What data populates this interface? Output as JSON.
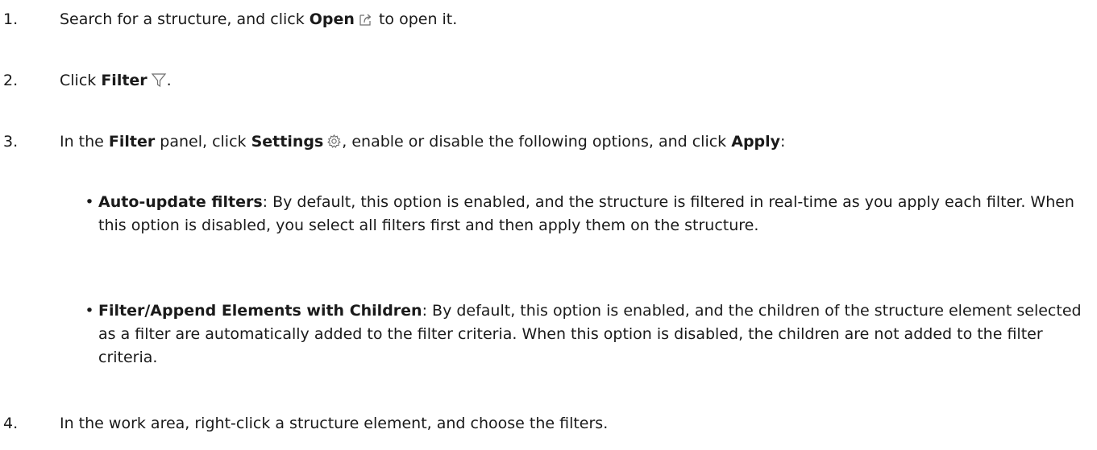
{
  "steps": [
    {
      "number": "1.",
      "pre": "Search for a structure, and click ",
      "bold": "Open",
      "icon": "open-in-icon",
      "post": " to open it."
    },
    {
      "number": "2.",
      "pre": "Click ",
      "bold": "Filter",
      "icon": "filter-funnel-icon",
      "post": "."
    },
    {
      "number": "3.",
      "pre": "In the ",
      "bold1": "Filter",
      "mid1": " panel, click ",
      "bold2": "Settings",
      "icon": "settings-gear-icon",
      "mid2": ", enable or disable the following options, and click ",
      "bold3": "Apply",
      "post": ":"
    },
    {
      "number": "4.",
      "text": "In the work area, right-click a structure element, and choose the filters."
    }
  ],
  "bullets": [
    {
      "dot": "•",
      "term": "Auto-update filters",
      "text": ": By default, this option is enabled, and the structure is filtered in real-time as you apply each filter. When this option is disabled, you select all filters first and then apply them on the structure."
    },
    {
      "dot": "•",
      "term": "Filter/Append Elements with Children",
      "text": ": By default, this option is enabled, and the children of the structure element selected as a filter are automatically added to the filter criteria. When this option is disabled, the children are not added to the filter criteria."
    }
  ]
}
